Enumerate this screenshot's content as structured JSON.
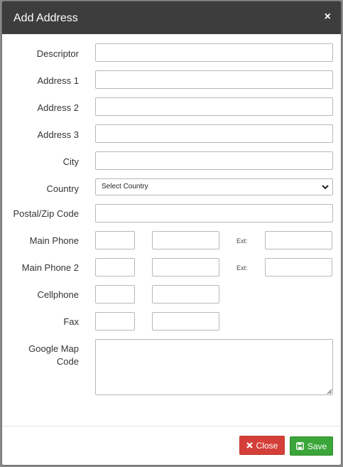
{
  "modal": {
    "title": "Add Address",
    "close_symbol": "×"
  },
  "form": {
    "descriptor_label": "Descriptor",
    "address1_label": "Address 1",
    "address2_label": "Address 2",
    "address3_label": "Address 3",
    "city_label": "City",
    "country_label": "Country",
    "country_selected": "Select Country",
    "postal_label": "Postal/Zip Code",
    "main_phone_label": "Main Phone",
    "main_phone2_label": "Main Phone 2",
    "cellphone_label": "Cellphone",
    "fax_label": "Fax",
    "google_map_label_line1": "Google Map",
    "google_map_label_line2": "Code",
    "ext_label": "Ext:"
  },
  "footer": {
    "close_label": "Close",
    "save_label": "Save"
  },
  "colors": {
    "header_bg": "#3d3d3d",
    "close_button": "#d43f3a",
    "save_button": "#3aa63a"
  },
  "icons": {
    "close_button_icon": "x-icon",
    "save_button_icon": "floppy-disk-icon",
    "select_icon": "chevron-down-icon"
  }
}
